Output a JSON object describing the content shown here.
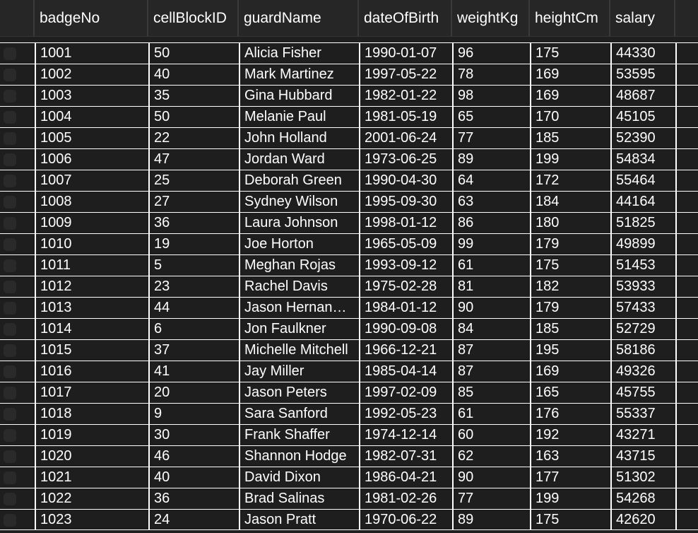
{
  "table": {
    "columns": [
      "badgeNo",
      "cellBlockID",
      "guardName",
      "dateOfBirth",
      "weightKg",
      "heightCm",
      "salary"
    ],
    "rows": [
      [
        "1001",
        "50",
        "Alicia Fisher",
        "1990-01-07",
        "96",
        "175",
        "44330"
      ],
      [
        "1002",
        "40",
        "Mark Martinez",
        "1997-05-22",
        "78",
        "169",
        "53595"
      ],
      [
        "1003",
        "35",
        "Gina Hubbard",
        "1982-01-22",
        "98",
        "169",
        "48687"
      ],
      [
        "1004",
        "50",
        "Melanie Paul",
        "1981-05-19",
        "65",
        "170",
        "45105"
      ],
      [
        "1005",
        "22",
        "John Holland",
        "2001-06-24",
        "77",
        "185",
        "52390"
      ],
      [
        "1006",
        "47",
        "Jordan Ward",
        "1973-06-25",
        "89",
        "199",
        "54834"
      ],
      [
        "1007",
        "25",
        "Deborah Green",
        "1990-04-30",
        "64",
        "172",
        "55464"
      ],
      [
        "1008",
        "27",
        "Sydney Wilson",
        "1995-09-30",
        "63",
        "184",
        "44164"
      ],
      [
        "1009",
        "36",
        "Laura Johnson",
        "1998-01-12",
        "86",
        "180",
        "51825"
      ],
      [
        "1010",
        "19",
        "Joe Horton",
        "1965-05-09",
        "99",
        "179",
        "49899"
      ],
      [
        "1011",
        "5",
        "Meghan Rojas",
        "1993-09-12",
        "61",
        "175",
        "51453"
      ],
      [
        "1012",
        "23",
        "Rachel Davis",
        "1975-02-28",
        "81",
        "182",
        "53933"
      ],
      [
        "1013",
        "44",
        "Jason Hernan…",
        "1984-01-12",
        "90",
        "179",
        "57433"
      ],
      [
        "1014",
        "6",
        "Jon Faulkner",
        "1990-09-08",
        "84",
        "185",
        "52729"
      ],
      [
        "1015",
        "37",
        "Michelle Mitchell",
        "1966-12-21",
        "87",
        "195",
        "58186"
      ],
      [
        "1016",
        "41",
        "Jay Miller",
        "1985-04-14",
        "87",
        "169",
        "49326"
      ],
      [
        "1017",
        "20",
        "Jason Peters",
        "1997-02-09",
        "85",
        "165",
        "45755"
      ],
      [
        "1018",
        "9",
        "Sara Sanford",
        "1992-05-23",
        "61",
        "176",
        "55337"
      ],
      [
        "1019",
        "30",
        "Frank Shaffer",
        "1974-12-14",
        "60",
        "192",
        "43271"
      ],
      [
        "1020",
        "46",
        "Shannon Hodge",
        "1982-07-31",
        "62",
        "163",
        "43715"
      ],
      [
        "1021",
        "40",
        "David Dixon",
        "1986-04-21",
        "90",
        "177",
        "51302"
      ],
      [
        "1022",
        "36",
        "Brad Salinas",
        "1981-02-26",
        "77",
        "199",
        "54268"
      ],
      [
        "1023",
        "24",
        "Jason Pratt",
        "1970-06-22",
        "89",
        "175",
        "42620"
      ]
    ]
  },
  "colors": {
    "background": "#1f1f1f",
    "header_background": "#262626",
    "text": "#ffffff",
    "grid_line": "#ffffff"
  }
}
